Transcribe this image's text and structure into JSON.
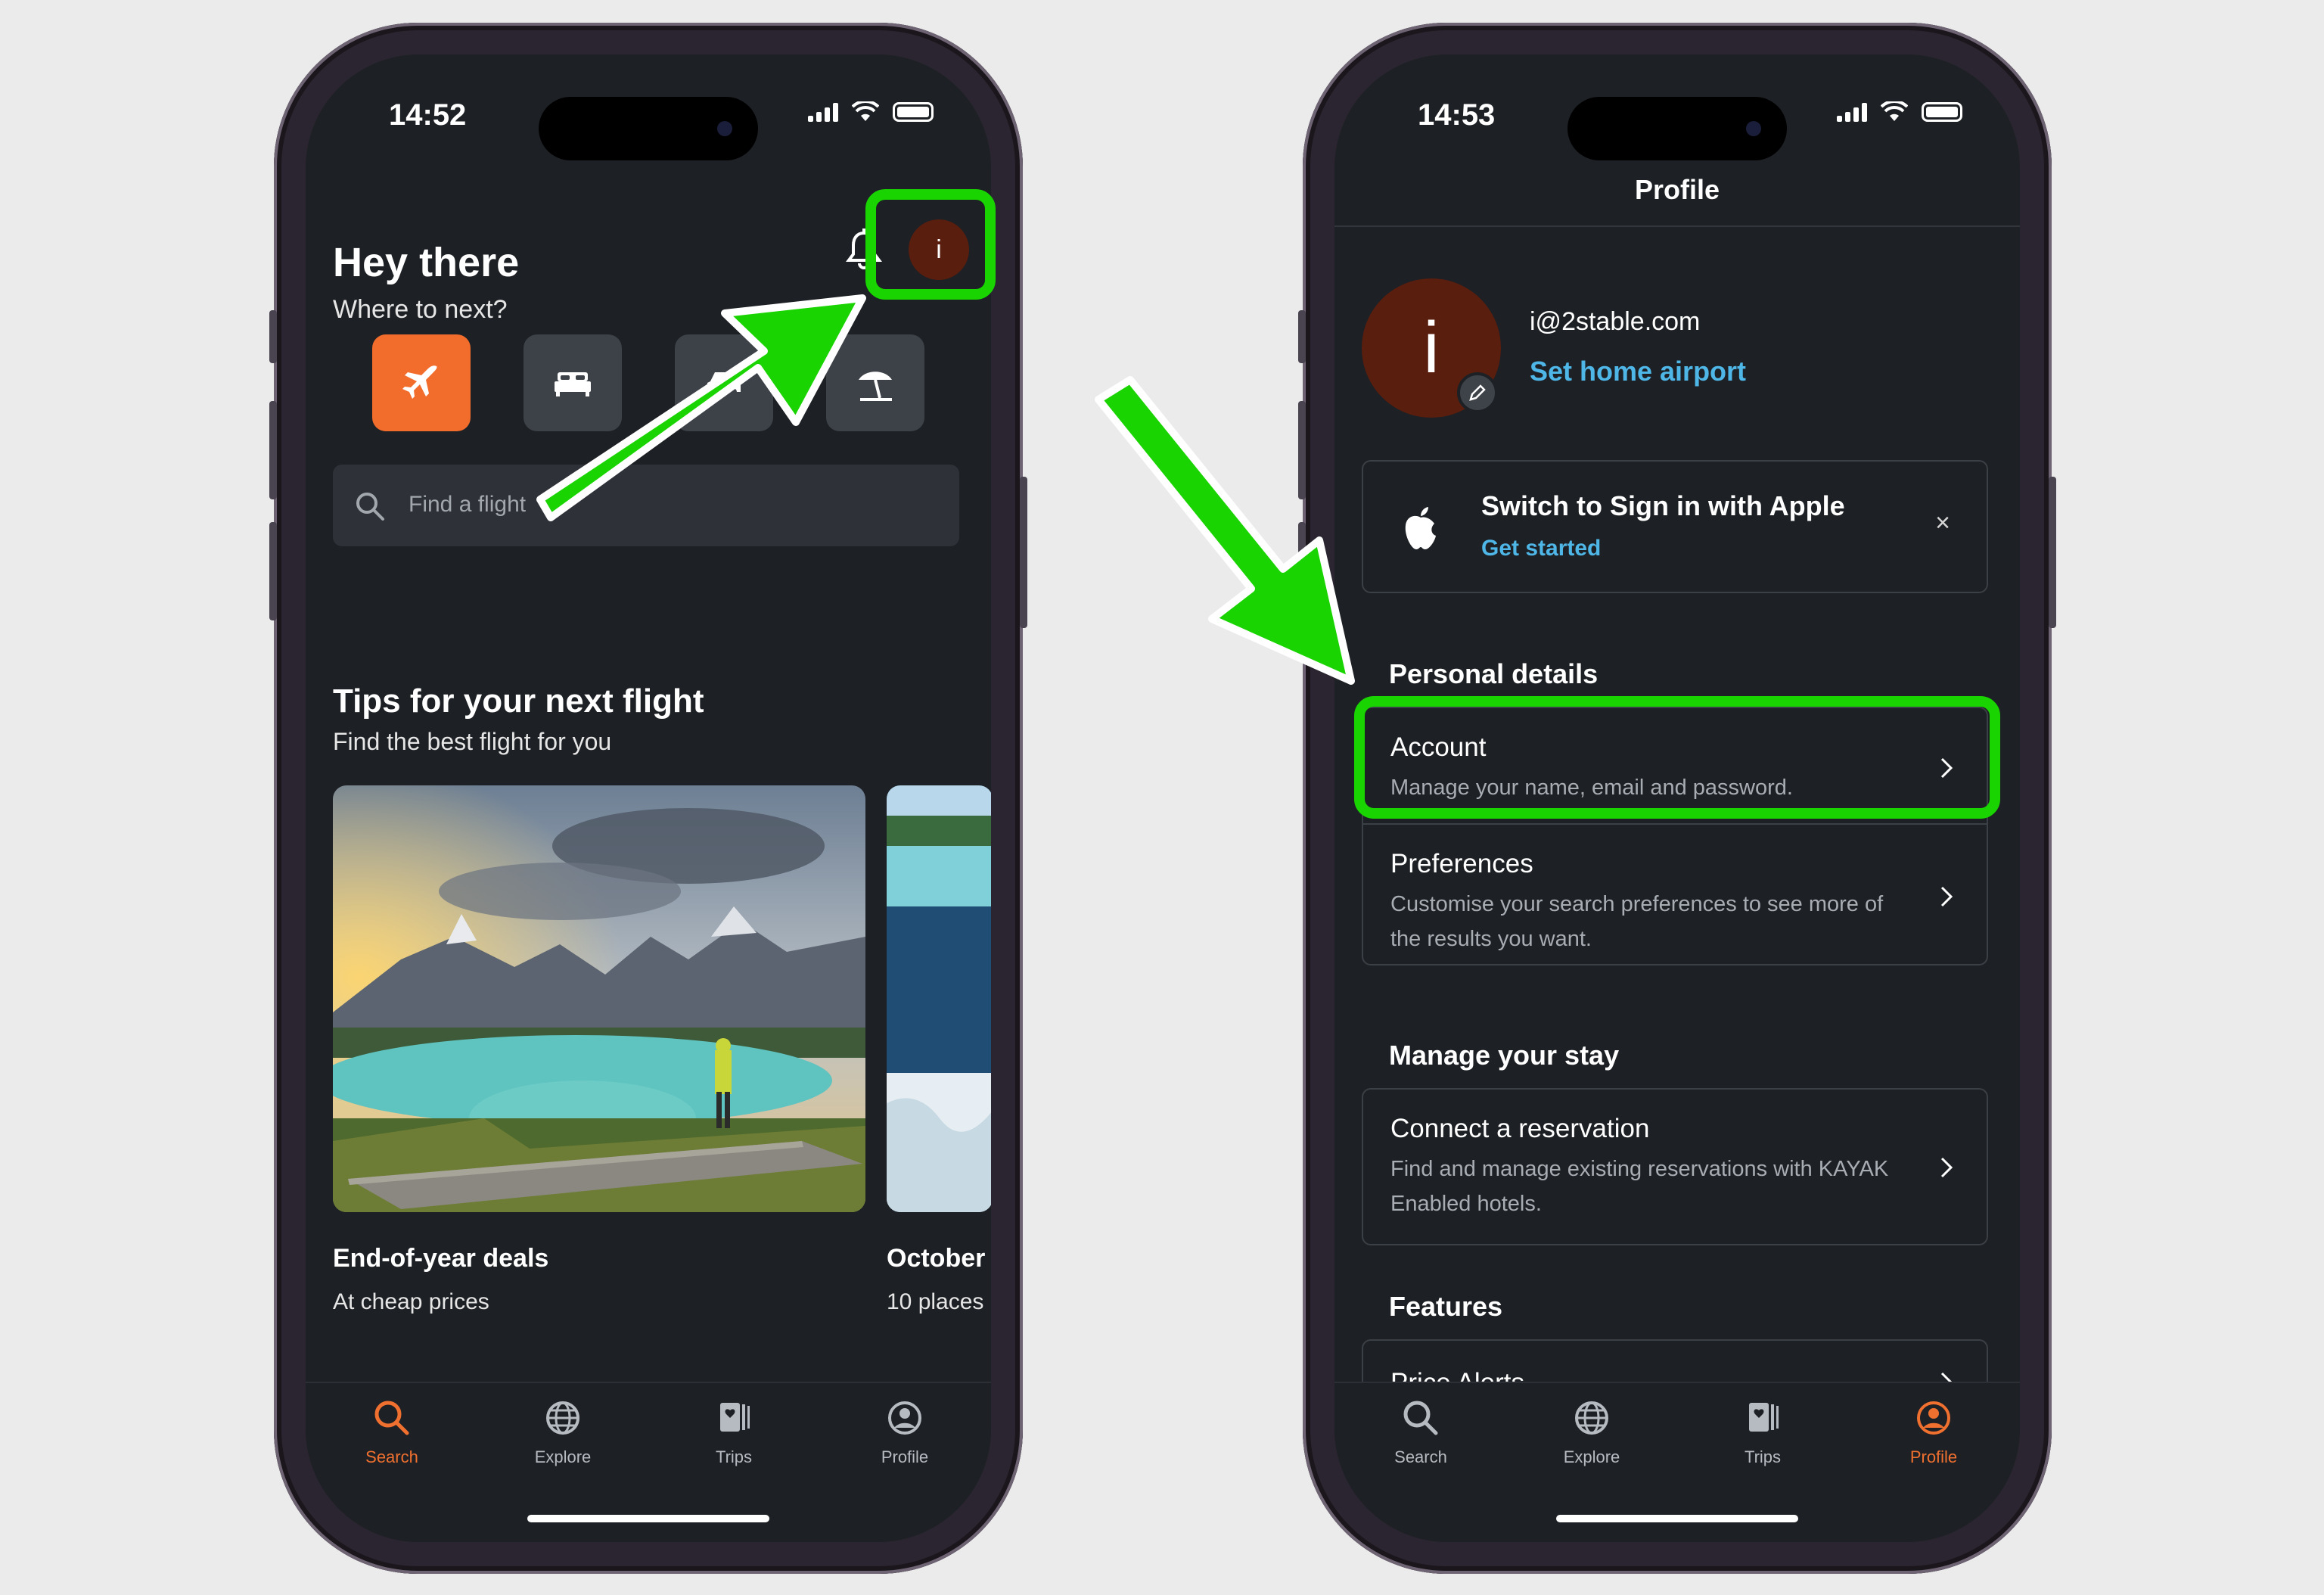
{
  "left_phone": {
    "status": {
      "time": "14:52"
    },
    "header": {
      "greeting": "Hey there",
      "subtitle": "Where to next?",
      "avatar_initial": "i"
    },
    "categories": [
      {
        "icon": "plane-icon",
        "active": true
      },
      {
        "icon": "bed-icon",
        "active": false
      },
      {
        "icon": "car-icon",
        "active": false
      },
      {
        "icon": "beach-umbrella-icon",
        "active": false
      }
    ],
    "search": {
      "placeholder": "Find a flight"
    },
    "tips": {
      "title": "Tips for your next flight",
      "subtitle": "Find the best flight for you",
      "cards": [
        {
          "title": "End-of-year deals",
          "subtitle": "At cheap prices"
        },
        {
          "title": "October",
          "subtitle": "10 places"
        }
      ]
    },
    "tabbar": [
      {
        "label": "Search",
        "icon": "search-icon",
        "active": true
      },
      {
        "label": "Explore",
        "icon": "globe-icon",
        "active": false
      },
      {
        "label": "Trips",
        "icon": "trips-icon",
        "active": false
      },
      {
        "label": "Profile",
        "icon": "profile-icon",
        "active": false
      }
    ]
  },
  "right_phone": {
    "status": {
      "time": "14:53"
    },
    "nav_title": "Profile",
    "profile": {
      "avatar_initial": "i",
      "email": "i@2stable.com",
      "set_home_airport": "Set home airport"
    },
    "apple_banner": {
      "title": "Switch to Sign in with Apple",
      "link": "Get started",
      "close": "×"
    },
    "sections": {
      "personal_details": {
        "heading": "Personal details",
        "items": [
          {
            "title": "Account",
            "subtitle": "Manage your name, email and password."
          },
          {
            "title": "Preferences",
            "subtitle": "Customise your search preferences to see more of the results you want."
          }
        ]
      },
      "manage_stay": {
        "heading": "Manage your stay",
        "items": [
          {
            "title": "Connect a reservation",
            "subtitle": "Find and manage existing reservations with KAYAK Enabled hotels."
          }
        ]
      },
      "features": {
        "heading": "Features",
        "items": [
          {
            "title": "Price Alerts"
          }
        ]
      }
    },
    "tabbar": [
      {
        "label": "Search",
        "icon": "search-icon",
        "active": false
      },
      {
        "label": "Explore",
        "icon": "globe-icon",
        "active": false
      },
      {
        "label": "Trips",
        "icon": "trips-icon",
        "active": false
      },
      {
        "label": "Profile",
        "icon": "profile-icon",
        "active": true
      }
    ]
  },
  "colors": {
    "accent": "#f26c2c",
    "link": "#4fb6e8",
    "highlight": "#19d400",
    "screen_bg": "#1d2024"
  }
}
